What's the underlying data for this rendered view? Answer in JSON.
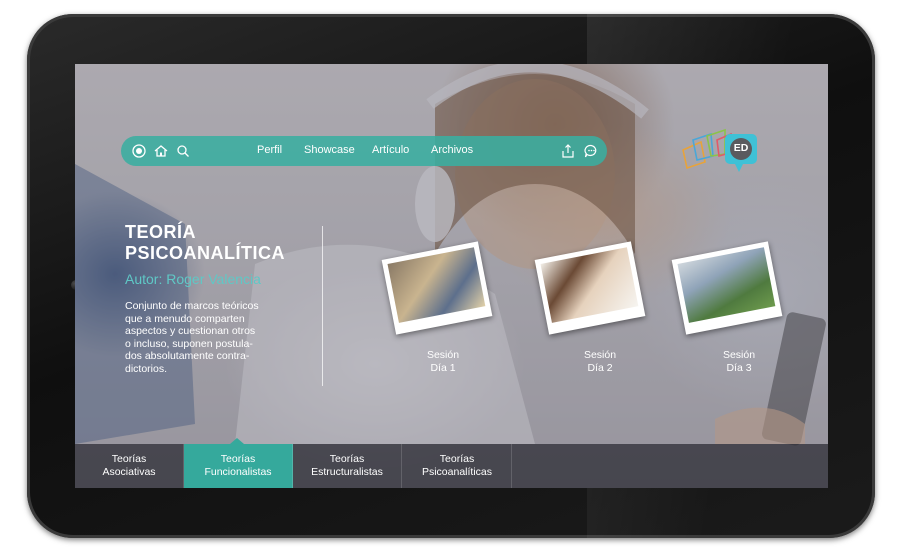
{
  "nav": {
    "links": [
      "Perfil",
      "Showcase",
      "Artículo",
      "Archivos"
    ],
    "icons": [
      "record-icon",
      "home-icon",
      "search-icon",
      "share-icon",
      "chat-icon"
    ]
  },
  "logo": {
    "badge": "ED"
  },
  "hero": {
    "title_line1": "TEORÍA",
    "title_line2": "PSICOANALÍTICA",
    "author": "Autor: Roger Valencia",
    "description": [
      "Conjunto de marcos teóricos",
      "que a menudo comparten",
      "aspectos y cuestionan otros",
      "o incluso, suponen postula-",
      "dos absolutamente contra-",
      "dictorios."
    ]
  },
  "sessions": [
    {
      "line1": "Sesión",
      "line2": "Día 1"
    },
    {
      "line1": "Sesión",
      "line2": "Día 2"
    },
    {
      "line1": "Sesión",
      "line2": "Día 3"
    }
  ],
  "tabs": [
    {
      "line1": "Teorías",
      "line2": "Asociativas",
      "active": false
    },
    {
      "line1": "Teorías",
      "line2": "Funcionalistas",
      "active": true
    },
    {
      "line1": "Teorías",
      "line2": "Estructuralistas",
      "active": false
    },
    {
      "line1": "Teorías",
      "line2": "Psicoanalíticas",
      "active": false
    }
  ],
  "colors": {
    "accent": "#3aaea0",
    "author": "#5fc8c6",
    "tabbar": "#28282f"
  }
}
